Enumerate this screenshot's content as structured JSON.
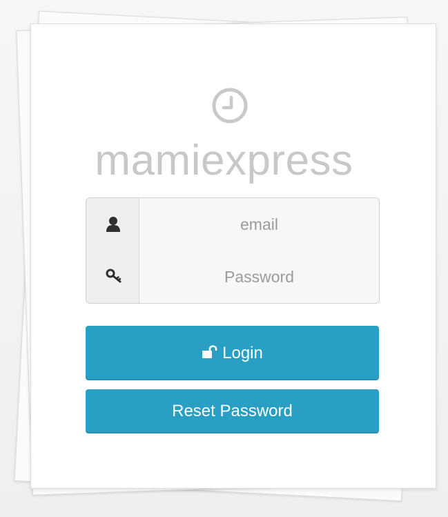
{
  "brand": {
    "name": "mamiexpress",
    "icon": "clock-icon"
  },
  "login_form": {
    "email": {
      "icon": "user-icon",
      "placeholder": "email",
      "value": ""
    },
    "password": {
      "icon": "key-icon",
      "placeholder": "Password",
      "value": ""
    }
  },
  "buttons": {
    "login_label": "Login",
    "login_icon": "unlock-icon",
    "reset_label": "Reset Password"
  },
  "colors": {
    "accent": "#2a9fc4",
    "brand_text": "#c8c8c8",
    "page_bg": "#f1f1f1"
  }
}
